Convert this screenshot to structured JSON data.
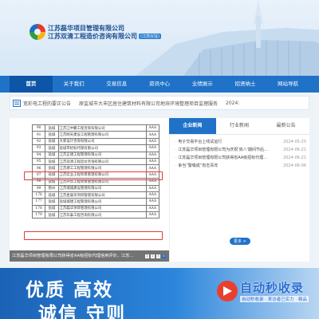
{
  "header": {
    "company_1": "江苏磊华项目管理有限公司",
    "company_2": "江苏双清工程造价咨询有限公司",
    "company_2_sub": "(江苏仪征)"
  },
  "nav": {
    "items": [
      "首页",
      "关于我们",
      "交易信息",
      "资讯中心",
      "业绩展示",
      "招贤纳士",
      "网站导航"
    ]
  },
  "notices": [
    "宽彩电工程的要正公告",
    "原监城市大丰区居住建筑材料有限公司地块环境整理项目监理服务",
    "2024:"
  ],
  "scan_table": {
    "rows": [
      [
        "90",
        "盐城",
        "江苏江中聚工程咨询有限公司",
        "AAA"
      ],
      [
        "91",
        "盐城",
        "江苏明天建设工程管理有限公司",
        "AAA"
      ],
      [
        "92",
        "盐城",
        "大新设计咨询有限公司",
        "AAA"
      ],
      [
        "93",
        "盐城",
        "盐城市招标代理有限公司",
        "AAA"
      ],
      [
        "94",
        "盐城",
        "江苏正建工程管理有限公司",
        "AAA"
      ],
      [
        "95",
        "盐城",
        "江苏双清工程造价咨询有限公司",
        "AAA"
      ],
      [
        "96",
        "盐城",
        "江苏建工工程管理有限公司",
        "AAA"
      ],
      [
        "97",
        "盐城",
        "江苏宏业工程项目管理有限公司",
        "AAA"
      ],
      [
        "98",
        "盐城",
        "江苏兴华工程项目管理有限公司",
        "AAA"
      ],
      [
        "99",
        "扬州",
        "江苏瑞诚建设管理有限公司",
        "AAA"
      ],
      [
        "176",
        "盐城",
        "江苏星辰华项目管理有限公司",
        "AAA"
      ],
      [
        "177",
        "盐城",
        "盐城城建工程管理有限公司",
        "AAA"
      ],
      [
        "178",
        "盐城",
        "江苏磊华项目管理有限公司",
        "AAA"
      ],
      [
        "179",
        "盐城",
        "江苏华泰工程咨询有限公司",
        "AAA"
      ]
    ]
  },
  "slider": {
    "caption": "江苏磊华项目管理有限公司获得省AA级招标代理信用评价，江苏...",
    "pages": [
      "1",
      "2",
      "3",
      "4"
    ],
    "active_page": 4
  },
  "news": {
    "tabs": [
      "企业新闻",
      "行业新闻",
      "最新公告"
    ],
    "items": [
      {
        "title": "电子交易平台上线试运行",
        "date": "2024-05-25"
      },
      {
        "title": "江苏磊华项目管理有限公司为庆祝'双八'期间节后新年评印迎中...",
        "date": "2024-06-21"
      },
      {
        "title": "江苏磊华项目管理有限公司获得省AA级招标代理信用评价，江...",
        "date": "2024-06-21"
      },
      {
        "title": "争当“警嗓成”有志青年",
        "date": "2024-06-06"
      }
    ],
    "more_label": "更多 >"
  },
  "banner": {
    "slogan_line1": "优质  高效",
    "slogan_line2": "诚信  守则"
  },
  "watermark": {
    "brand": "自动秒收录",
    "tagline": "自动秒收录 · 来访者已实力 · 精品"
  }
}
